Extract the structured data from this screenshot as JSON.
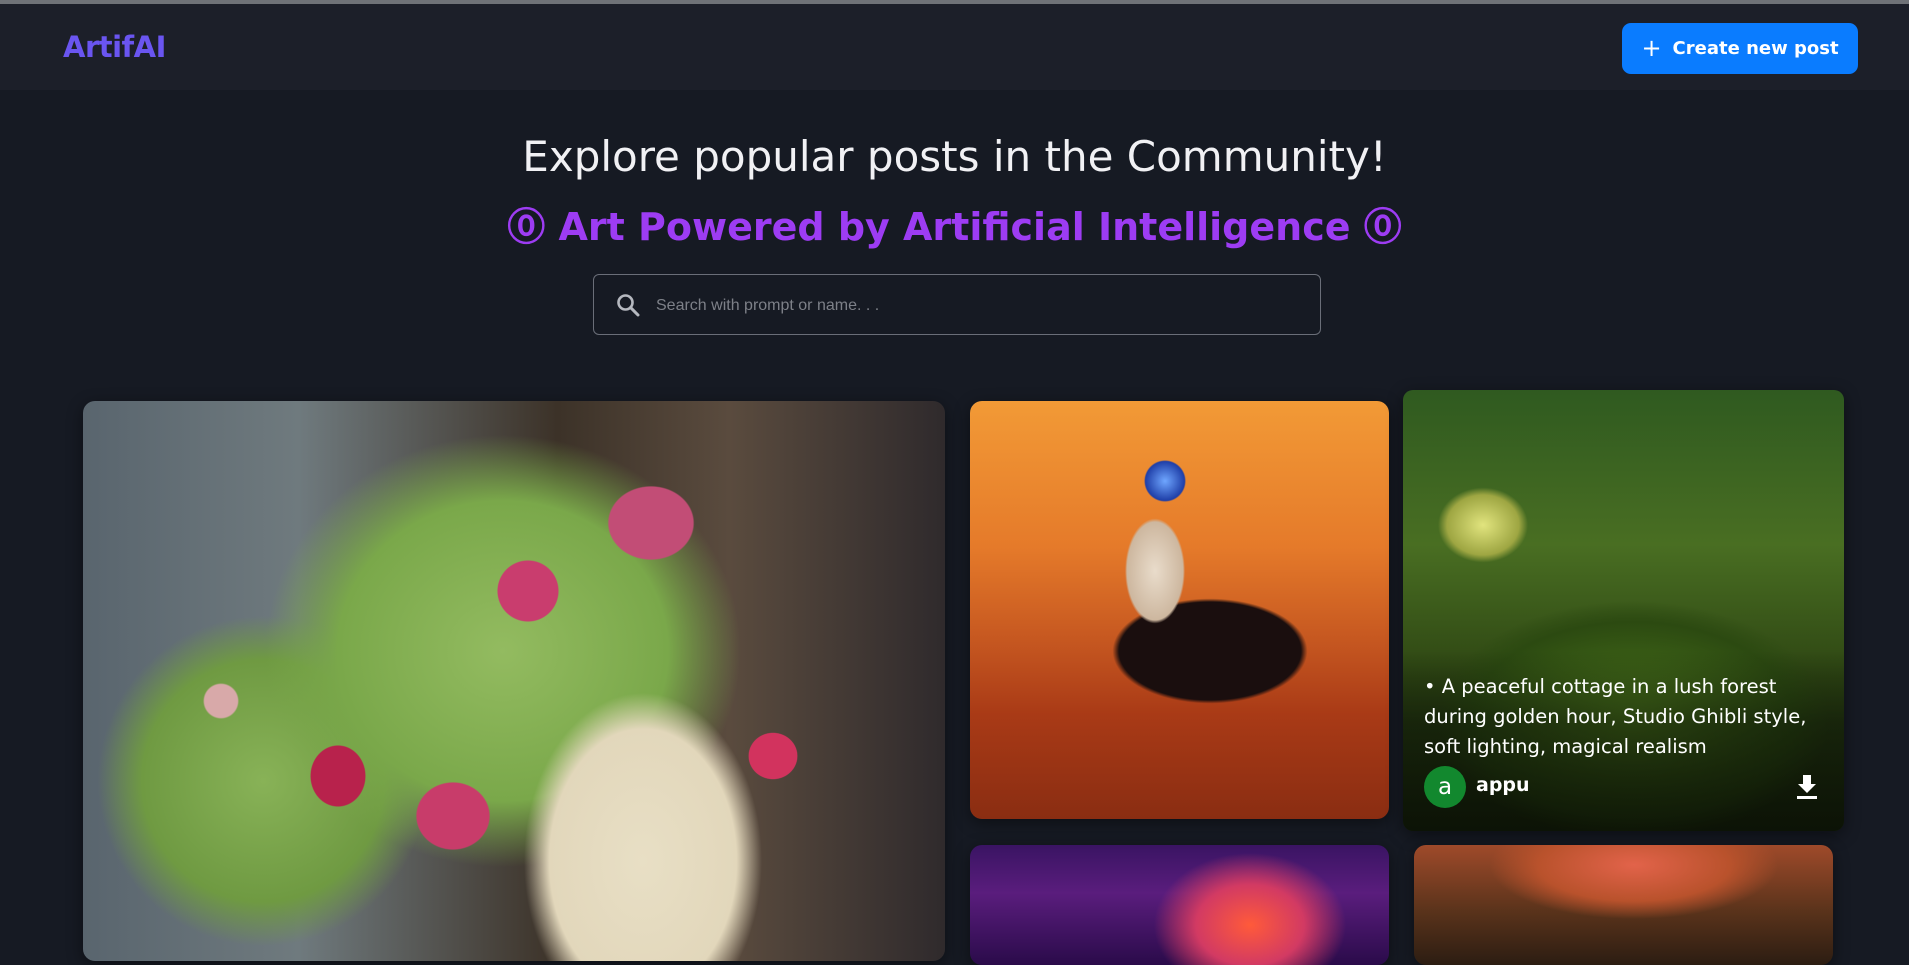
{
  "app": {
    "logo": "ArtifAI",
    "brand_color": "#6a55f0",
    "accent_color": "#0a7cff"
  },
  "header": {
    "create_button_label": "Create new post",
    "create_button_icon": "plus-icon"
  },
  "hero": {
    "title": "Explore popular posts in the Community!",
    "subtitle": "⓪ Art Powered by Artificial Intelligence ⓪",
    "subtitle_color": "#9d3cf3"
  },
  "search": {
    "placeholder": "Search with prompt or name. . .",
    "value": "",
    "icon": "search-icon"
  },
  "posts": [
    {
      "image": "woman with leaves and roses crown"
    },
    {
      "image": "astronaut riding a horse on mars"
    },
    {
      "image": "cottage in forest",
      "prompt": "• A peaceful cottage in a lush forest during golden hour, Studio Ghibli style, soft lighting, magical realism",
      "author_initial": "a",
      "author_name": "appu",
      "avatar_color": "#12882e",
      "action_icon": "download-icon"
    },
    {
      "image": "neon city"
    },
    {
      "image": "forest sunset"
    }
  ]
}
